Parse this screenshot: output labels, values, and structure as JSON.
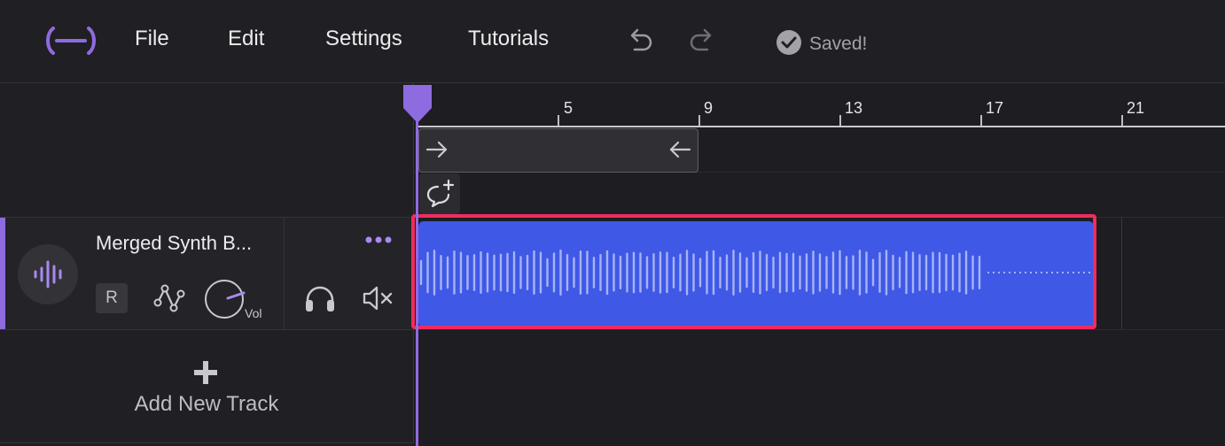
{
  "menu": {
    "file": "File",
    "edit": "Edit",
    "settings": "Settings",
    "tutorials": "Tutorials"
  },
  "status": {
    "saved_text": "Saved!"
  },
  "ruler": {
    "labels": [
      "5",
      "9",
      "13",
      "17",
      "21"
    ]
  },
  "track": {
    "name": "Merged Synth B...",
    "record_label": "R",
    "volume_label": "Vol"
  },
  "add_track": {
    "label": "Add New Track"
  },
  "colors": {
    "accent": "#8f6be0",
    "clip": "#3f58e6",
    "waveform": "#a6b4f5",
    "selection": "#ee2d5f"
  },
  "icons": {
    "logo": "logo-icon",
    "undo": "undo-icon",
    "redo": "redo-icon",
    "saved": "check-circle-icon",
    "track": "waveform-icon",
    "automation": "automation-icon",
    "headphones": "headphones-icon",
    "mute": "mute-icon",
    "more": "more-icon",
    "add": "plus-icon",
    "comment": "add-comment-icon"
  }
}
